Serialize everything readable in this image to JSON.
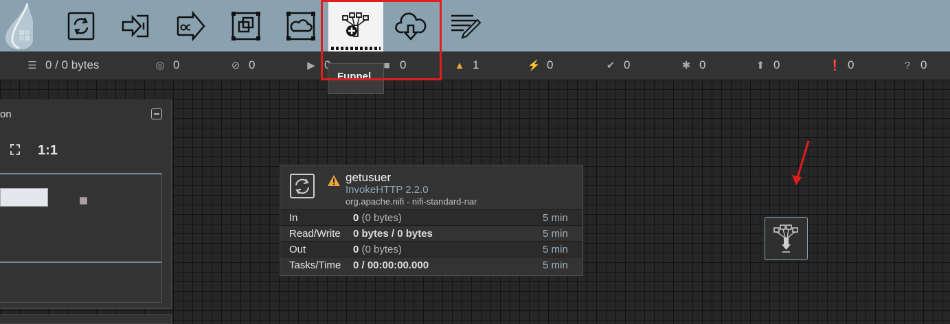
{
  "toolbar": {
    "buttons": [
      {
        "name": "processor",
        "icon": "processor-icon"
      },
      {
        "name": "input-port",
        "icon": "input-port-icon"
      },
      {
        "name": "output-port",
        "icon": "output-port-icon"
      },
      {
        "name": "process-group",
        "icon": "process-group-icon"
      },
      {
        "name": "remote-process-group",
        "icon": "remote-process-group-icon"
      },
      {
        "name": "funnel",
        "icon": "funnel-icon"
      },
      {
        "name": "import-from-registry",
        "icon": "cloud-download-icon"
      },
      {
        "name": "label",
        "icon": "label-icon"
      }
    ],
    "tooltip": "Funnel"
  },
  "status": {
    "queued": "0 / 0 bytes",
    "transmitting": "0",
    "not_transmitting": "0",
    "running": "0",
    "stopped": "0",
    "invalid": "1",
    "disabled": "0",
    "up_to_date": "0",
    "locally_modified": "0",
    "stale": "0",
    "locally_modified_and_stale": "0",
    "sync_failure": "0"
  },
  "panel": {
    "title": "on"
  },
  "processor": {
    "name": "getusuer",
    "type": "InvokeHTTP 2.2.0",
    "bundle": "org.apache.nifi - nifi-standard-nar",
    "rows": [
      {
        "label": "In",
        "count": "0",
        "detail": "(0 bytes)",
        "time": "5 min"
      },
      {
        "label": "Read/Write",
        "value": "0 bytes / 0 bytes",
        "time": "5 min"
      },
      {
        "label": "Out",
        "count": "0",
        "detail": "(0 bytes)",
        "time": "5 min"
      },
      {
        "label": "Tasks/Time",
        "value": "0 / 00:00:00.000",
        "time": "5 min"
      }
    ]
  },
  "colors": {
    "toolbar_bg": "#8aa2b0",
    "highlight": "#e11d1d",
    "warning": "#e8a53d",
    "type_text": "#8ea7b8"
  }
}
